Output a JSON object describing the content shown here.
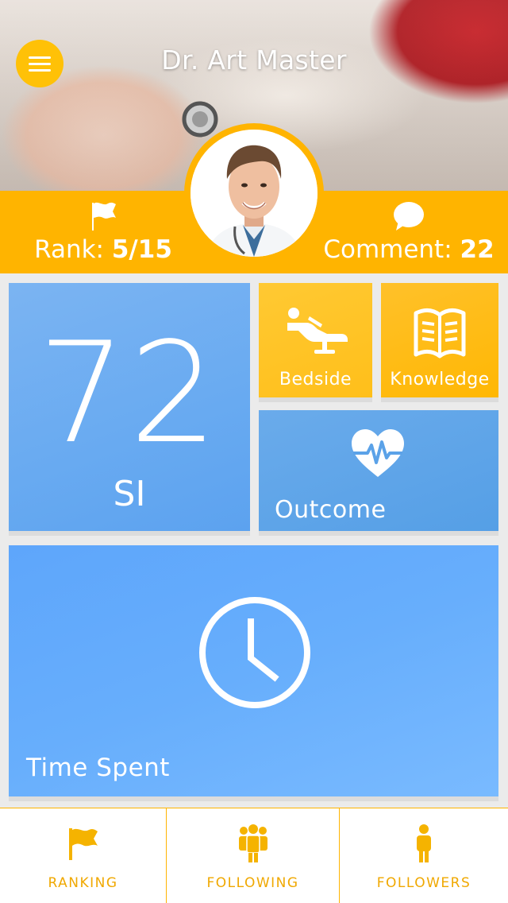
{
  "header": {
    "doctor_name": "Dr. Art Master"
  },
  "stats": {
    "rank_label": "Rank:",
    "rank_value": "5/15",
    "comment_label": "Comment:",
    "comment_value": "22"
  },
  "tiles": {
    "si_value": "72",
    "si_label": "SI",
    "bedside_label": "Bedside",
    "knowledge_label": "Knowledge",
    "outcome_label": "Outcome",
    "time_label": "Time Spent"
  },
  "nav": {
    "ranking": "RANKING",
    "following": "FOLLOWING",
    "followers": "FOLLOWERS"
  },
  "colors": {
    "accent": "#ffb400",
    "blue": "#68aaf1"
  },
  "icons": [
    "menu-icon",
    "flag-icon",
    "comment-icon",
    "bed-icon",
    "book-icon",
    "heartbeat-icon",
    "clock-icon",
    "group-icon",
    "person-icon"
  ]
}
